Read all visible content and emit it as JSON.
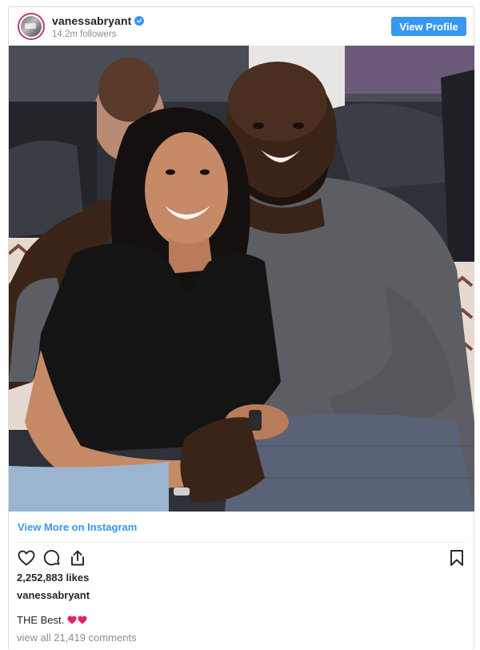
{
  "header": {
    "username": "vanessabryant",
    "followers": "14.2m followers",
    "view_profile_label": "View Profile"
  },
  "post": {
    "photo_description": "",
    "view_more_label": "View More on Instagram",
    "likes": "2,252,883 likes",
    "owner": "vanessabryant",
    "caption_text": "THE Best.",
    "view_comments": "view all 21,419 comments"
  },
  "icons": {
    "avatar": "avatar",
    "verified": "verified-badge-icon",
    "like": "heart-outline-icon",
    "comment": "comment-bubble-icon",
    "share": "share-upload-icon",
    "save": "bookmark-icon",
    "caption_hearts": "red-heart-emoji"
  },
  "colors": {
    "link_blue": "#3897f0",
    "text": "#262626",
    "muted": "#8e8e8e",
    "heart_red": "#e0245e"
  }
}
